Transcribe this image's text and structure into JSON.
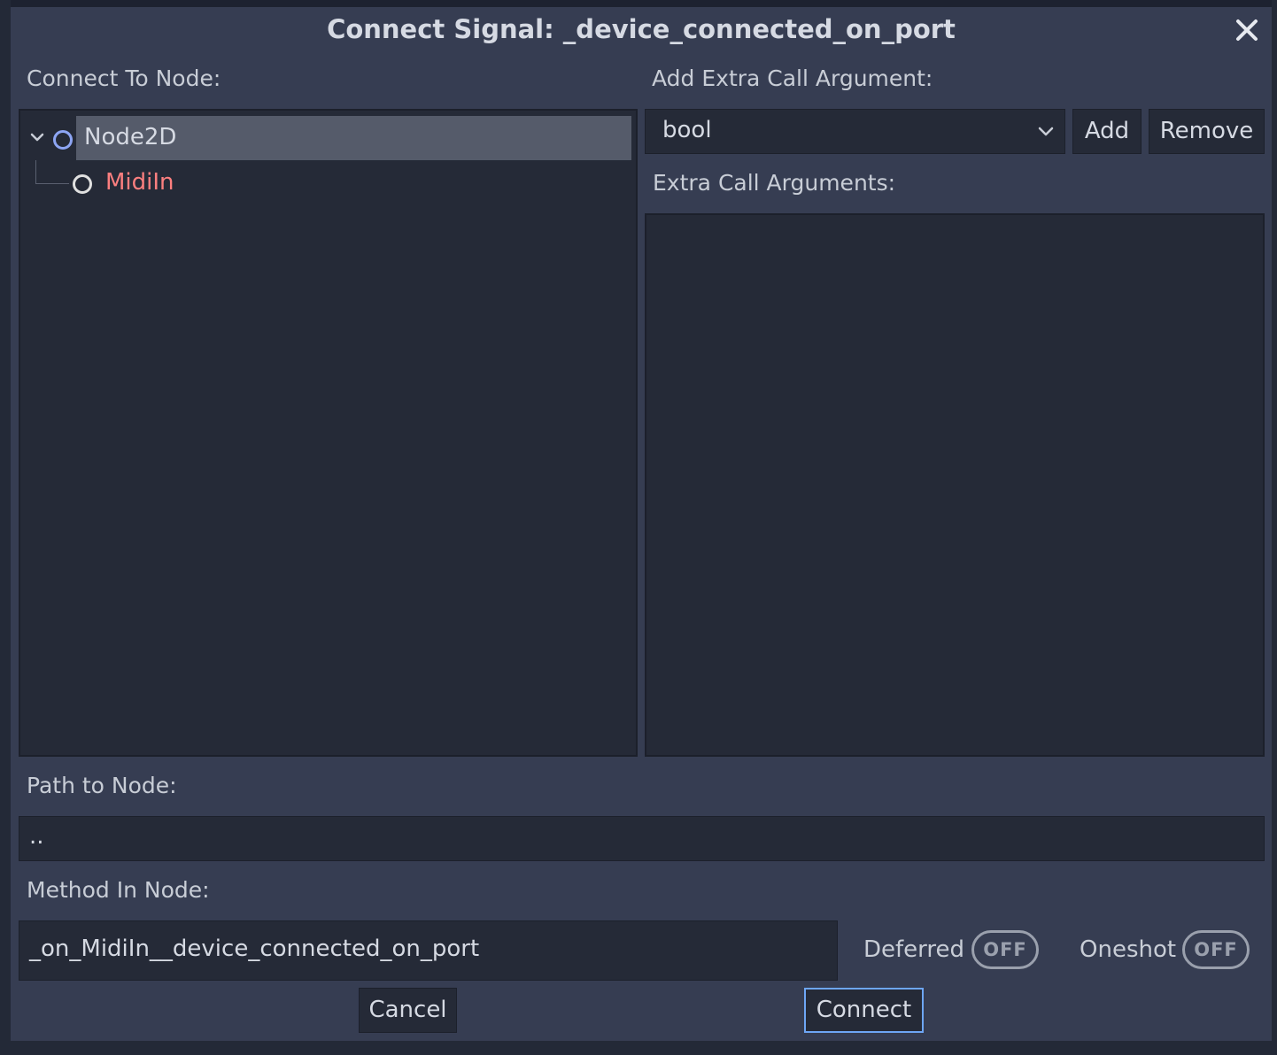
{
  "dialog": {
    "title": "Connect Signal: _device_connected_on_port",
    "close_icon": "close-icon"
  },
  "left": {
    "connect_to_node_label": "Connect To Node:",
    "tree": [
      {
        "name": "Node2D",
        "color": "#d6dae3",
        "icon": "node2d-circle-icon",
        "icon_color": "#8da5f3",
        "selected": true,
        "expanded": true
      },
      {
        "name": "MidiIn",
        "color": "#fc7f7f",
        "icon": "node-circle-icon",
        "icon_color": "#e0e0e0",
        "selected": false
      }
    ]
  },
  "right": {
    "add_extra_arg_label": "Add Extra Call Argument:",
    "type_select_value": "bool",
    "add_button": "Add",
    "remove_button": "Remove",
    "extra_args_label": "Extra Call Arguments:",
    "extra_args": []
  },
  "path": {
    "label": "Path to Node:",
    "value": ".."
  },
  "method": {
    "label": "Method In Node:",
    "value": "_on_MidiIn__device_connected_on_port",
    "deferred_label": "Deferred",
    "deferred_state": "OFF",
    "oneshot_label": "Oneshot",
    "oneshot_state": "OFF"
  },
  "footer": {
    "cancel_button": "Cancel",
    "connect_button": "Connect"
  },
  "colors": {
    "dialog_bg": "#363d52",
    "panel_bg": "#252a37",
    "selected_row": "#555b6a",
    "focus_border": "#6ea6f5"
  }
}
